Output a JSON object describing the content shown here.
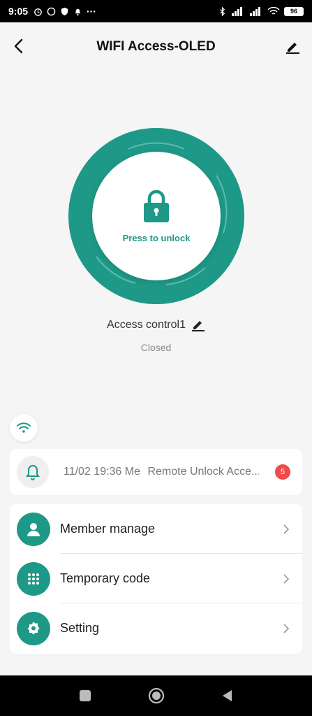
{
  "status_bar": {
    "time": "9:05",
    "battery": "96",
    "left_icons": [
      "alarm-icon",
      "whatsapp-icon",
      "shield-icon",
      "notification-bell-icon",
      "more-dots-icon"
    ],
    "right_icons": [
      "bluetooth-icon",
      "signal-icon",
      "signal-icon",
      "wifi-icon",
      "battery-icon"
    ]
  },
  "header": {
    "title": "WIFI Access-OLED"
  },
  "lock": {
    "press_label": "Press to unlock",
    "accent": "#1e9887"
  },
  "device": {
    "name": "Access control1",
    "status": "Closed"
  },
  "log": {
    "timestamp": "11/02 19:36 Me",
    "message": "Remote Unlock Acce...",
    "badge_count": "5"
  },
  "menu": {
    "items": [
      {
        "label": "Member manage",
        "icon": "person-icon"
      },
      {
        "label": "Temporary code",
        "icon": "keypad-icon"
      },
      {
        "label": "Setting",
        "icon": "gear-icon"
      }
    ]
  },
  "nav": {
    "icons": [
      "square-recents-icon",
      "circle-home-icon",
      "triangle-back-icon"
    ]
  }
}
